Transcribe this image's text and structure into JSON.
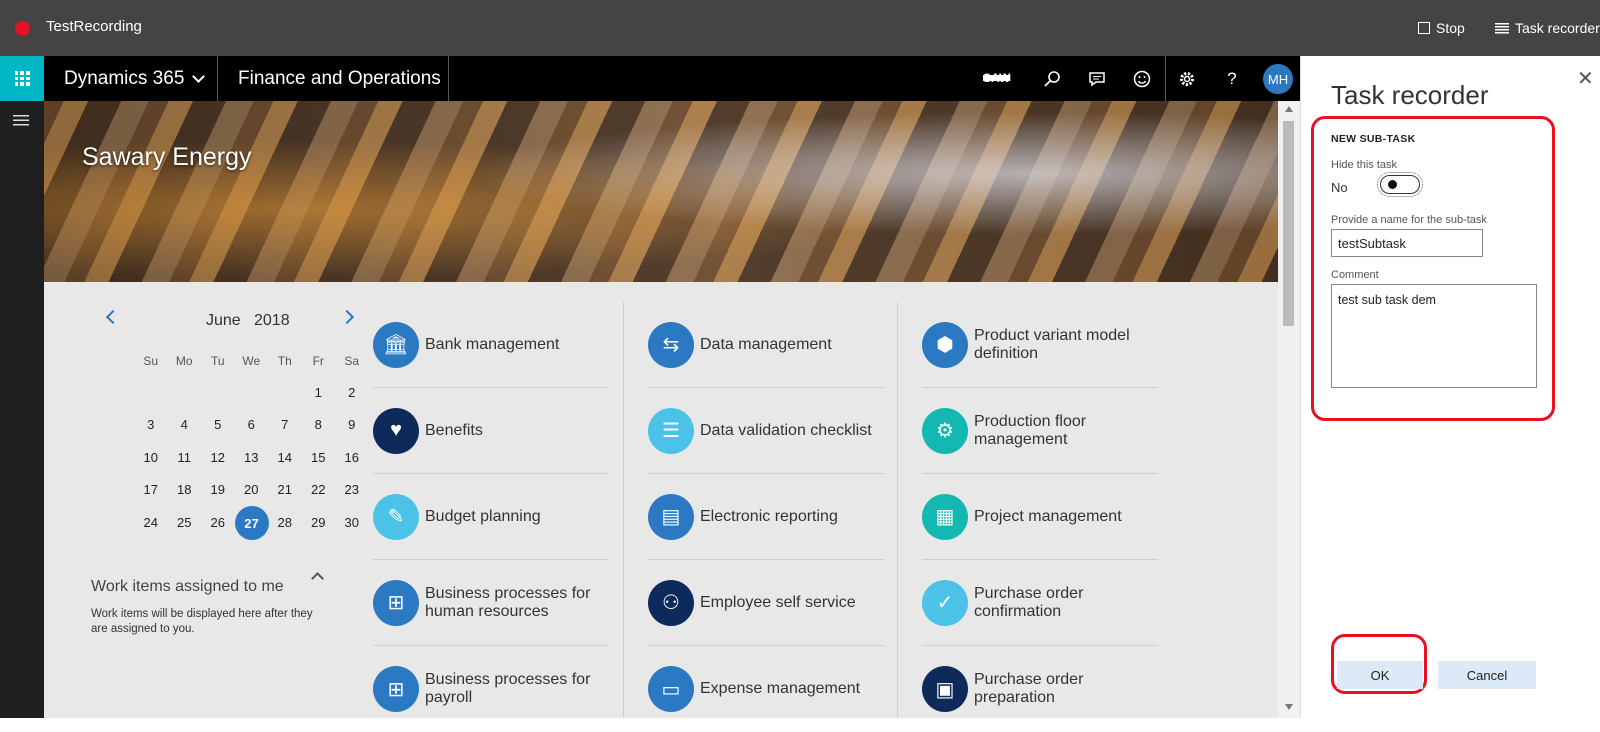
{
  "recorder_bar": {
    "title": "TestRecording",
    "stop_label": "Stop",
    "task_recorder_label": "Task recorder"
  },
  "navbar": {
    "brand": "Dynamics 365",
    "module": "Finance and Operations",
    "company": "SAW",
    "avatar_initials": "MH",
    "icons": [
      "search-icon",
      "chat-icon",
      "smiley-icon",
      "gear-icon",
      "help-icon"
    ]
  },
  "banner": {
    "title": "Sawary Energy"
  },
  "calendar": {
    "month": "June",
    "year": "2018",
    "days_of_week": [
      "Su",
      "Mo",
      "Tu",
      "We",
      "Th",
      "Fr",
      "Sa"
    ],
    "weeks": [
      [
        "",
        "",
        "",
        "",
        "",
        "1",
        "2"
      ],
      [
        "3",
        "4",
        "5",
        "6",
        "7",
        "8",
        "9"
      ],
      [
        "10",
        "11",
        "12",
        "13",
        "14",
        "15",
        "16"
      ],
      [
        "17",
        "18",
        "19",
        "20",
        "21",
        "22",
        "23"
      ],
      [
        "24",
        "25",
        "26",
        "27",
        "28",
        "29",
        "30"
      ]
    ],
    "today": "27"
  },
  "work_items": {
    "heading": "Work items assigned to me",
    "text": "Work items will be displayed here after they are assigned to you."
  },
  "tiles": {
    "col1": [
      {
        "label": "Bank management",
        "icon": "bank-icon",
        "color": "#2b79c2"
      },
      {
        "label": "Benefits",
        "icon": "benefits-icon",
        "color": "#0d2a5a"
      },
      {
        "label": "Budget planning",
        "icon": "budget-icon",
        "color": "#4cc2e8"
      },
      {
        "label": "Business processes for human resources",
        "icon": "process-icon",
        "color": "#2b79c2"
      },
      {
        "label": "Business processes for payroll",
        "icon": "process-icon",
        "color": "#2b79c2"
      }
    ],
    "col2": [
      {
        "label": "Data management",
        "icon": "data-icon",
        "color": "#2b79c2"
      },
      {
        "label": "Data validation checklist",
        "icon": "checklist-icon",
        "color": "#4cc2e8"
      },
      {
        "label": "Electronic reporting",
        "icon": "report-icon",
        "color": "#2b79c2"
      },
      {
        "label": "Employee self service",
        "icon": "employee-icon",
        "color": "#0d2a5a"
      },
      {
        "label": "Expense management",
        "icon": "expense-icon",
        "color": "#2b79c2"
      }
    ],
    "col3": [
      {
        "label": "Product variant model definition",
        "icon": "product-icon",
        "color": "#2b79c2"
      },
      {
        "label": "Production floor management",
        "icon": "production-icon",
        "color": "#14b8b3"
      },
      {
        "label": "Project management",
        "icon": "project-icon",
        "color": "#14b8b3"
      },
      {
        "label": "Purchase order confirmation",
        "icon": "purchase-confirm-icon",
        "color": "#4cc2e8"
      },
      {
        "label": "Purchase order preparation",
        "icon": "purchase-prep-icon",
        "color": "#0d2a5a"
      }
    ]
  },
  "panel": {
    "title": "Task recorder",
    "section": "NEW SUB-TASK",
    "hide_label": "Hide this task",
    "hide_value": "No",
    "name_label": "Provide a name for the sub-task",
    "name_value": "testSubtask",
    "comment_label": "Comment",
    "comment_value": "test sub task dem",
    "ok_label": "OK",
    "cancel_label": "Cancel"
  },
  "colors": {
    "accent": "#2b79c2",
    "waffle": "#00b7c3",
    "highlight": "#e81123"
  }
}
